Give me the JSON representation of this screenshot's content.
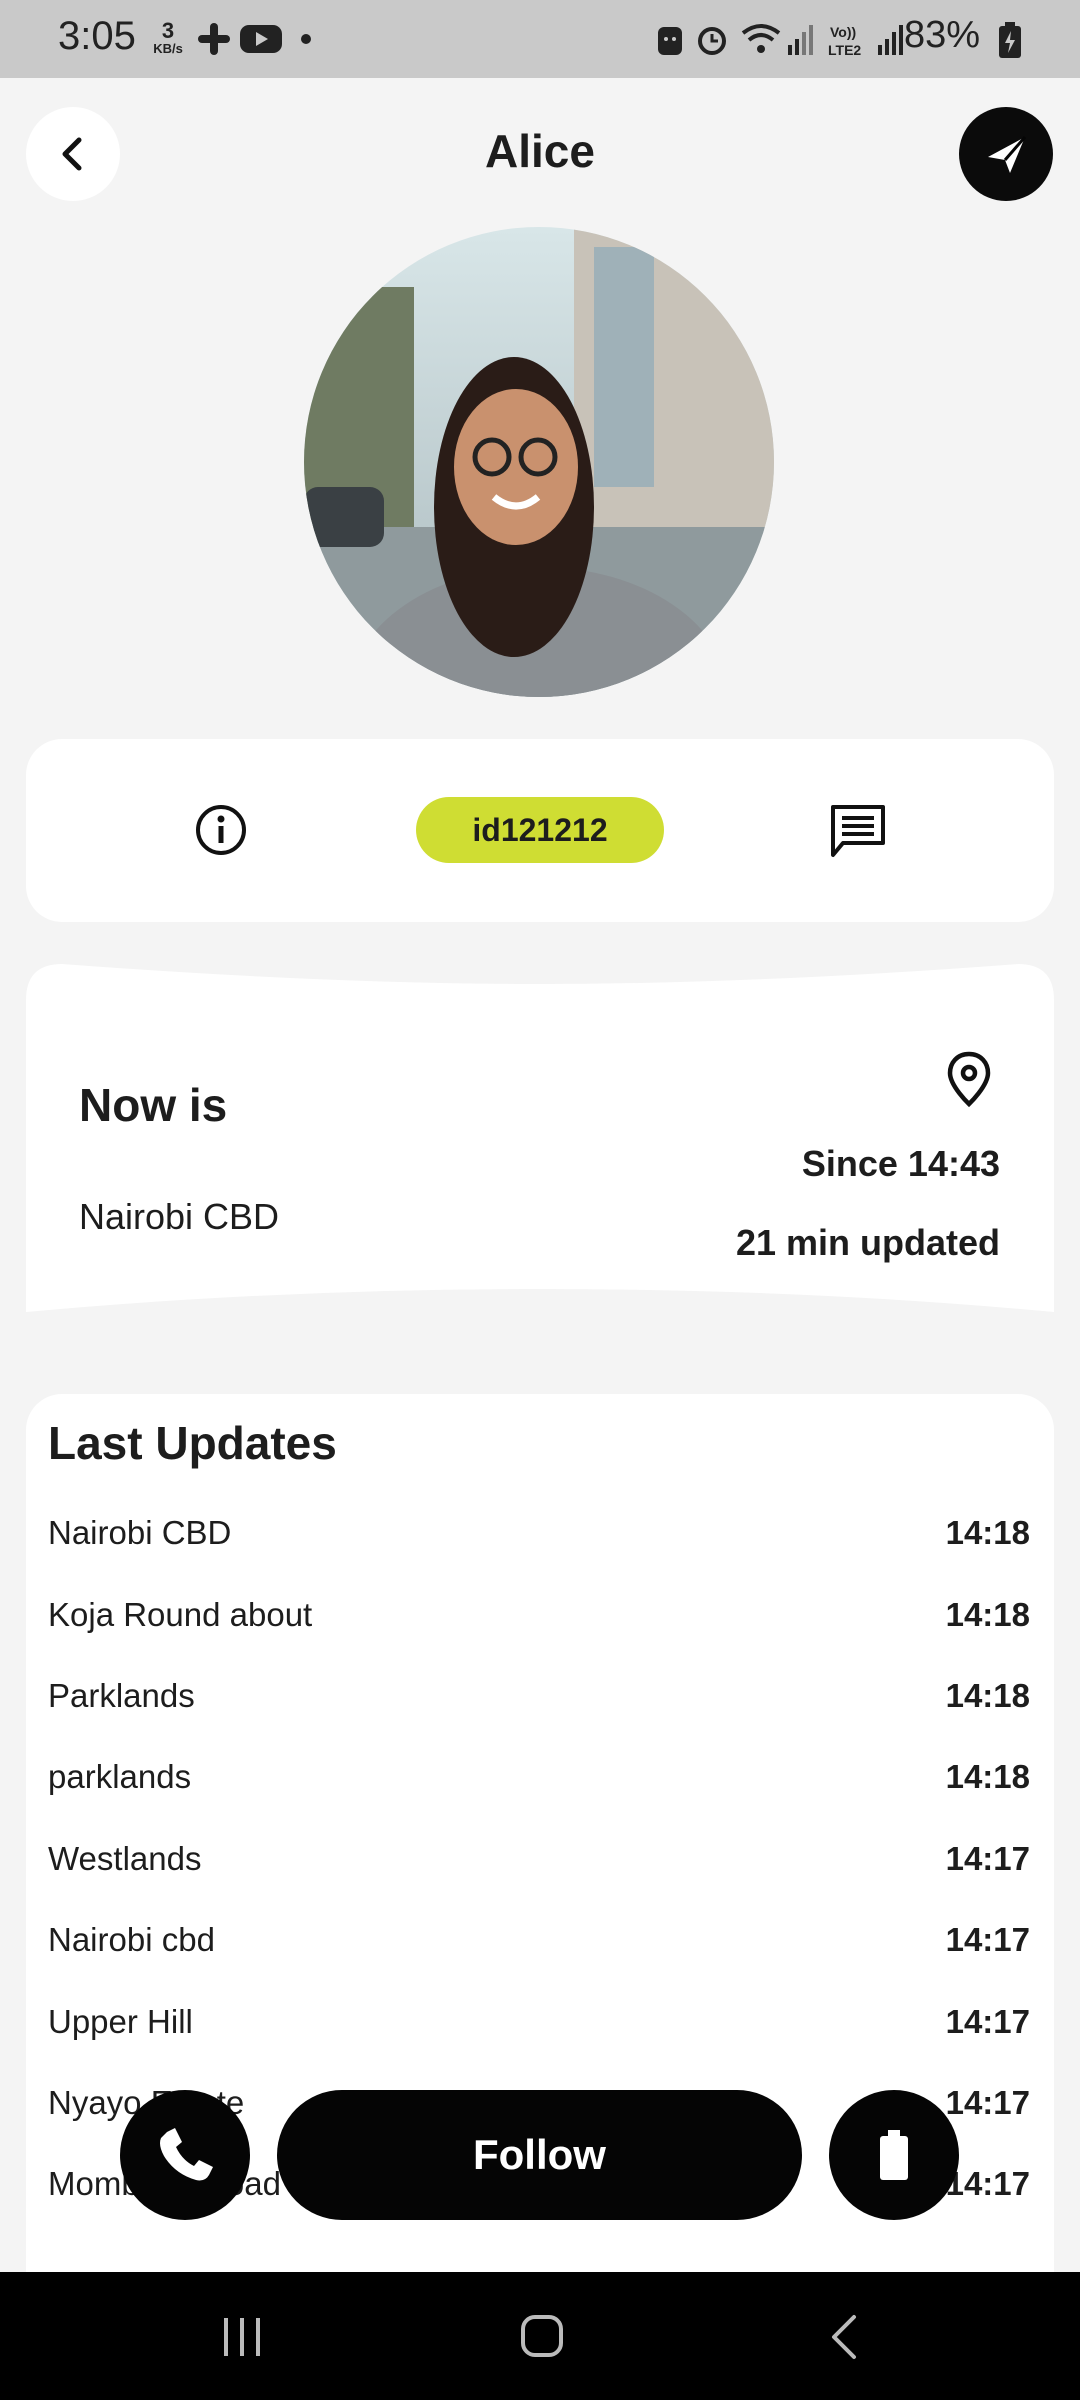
{
  "status_bar": {
    "time": "3:05",
    "speed_value": "3",
    "speed_unit": "KB/s",
    "battery": "83%",
    "icons": [
      "slack-icon",
      "youtube-icon",
      "dot-icon",
      "android-icon",
      "alarm-icon",
      "wifi-icon",
      "signal-icon",
      "volte-icon",
      "signal-icon",
      "battery-icon"
    ]
  },
  "header": {
    "title": "Alice"
  },
  "info": {
    "id": "id121212"
  },
  "location": {
    "heading": "Now is",
    "place": "Nairobi CBD",
    "since": "Since 14:43",
    "updated": "21 min updated"
  },
  "updates": {
    "heading": "Last Updates",
    "items": [
      {
        "place": "Nairobi CBD",
        "time": "14:18"
      },
      {
        "place": "Koja Round about",
        "time": "14:18"
      },
      {
        "place": "Parklands",
        "time": "14:18"
      },
      {
        "place": "parklands",
        "time": "14:18"
      },
      {
        "place": "Westlands",
        "time": "14:17"
      },
      {
        "place": "Nairobi cbd",
        "time": "14:17"
      },
      {
        "place": "Upper Hill",
        "time": "14:17"
      },
      {
        "place": "Nyayo Estate",
        "time": "14:17"
      },
      {
        "place": "Mombasa Road",
        "time": "14:17"
      }
    ]
  },
  "actions": {
    "follow_label": "Follow"
  },
  "colors": {
    "accent": "#cfdd33",
    "dark": "#050505",
    "background": "#f4f4f4"
  }
}
